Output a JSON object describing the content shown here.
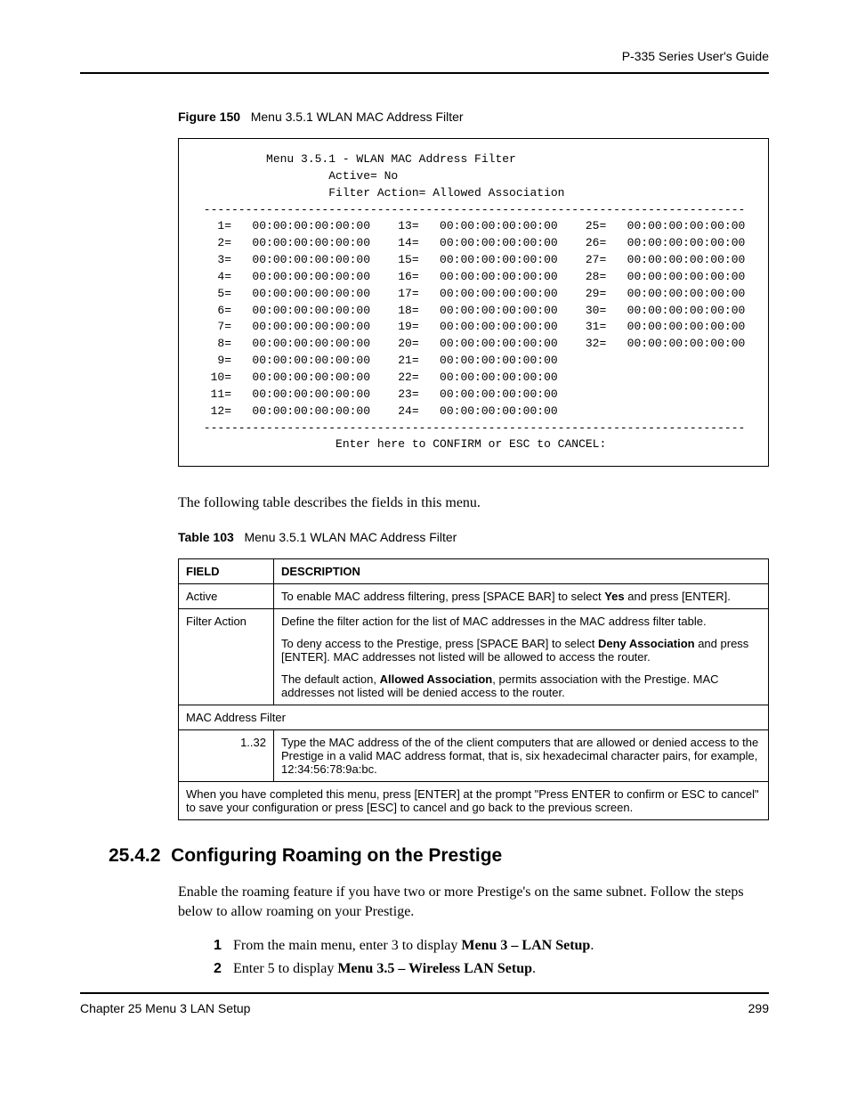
{
  "header": {
    "running": "P-335 Series User's Guide"
  },
  "figure": {
    "num": "Figure 150",
    "title": "Menu 3.5.1 WLAN MAC Address Filter"
  },
  "terminal": {
    "title": "Menu 3.5.1 - WLAN MAC Address Filter",
    "active_label": "Active=",
    "active_value": "No",
    "filter_action_label": "Filter Action=",
    "filter_action_value": "Allowed Association",
    "separator": "------------------------------------------------------------------------------",
    "footer": "Enter here to CONFIRM or ESC to CANCEL:",
    "mac": "00:00:00:00:00:00",
    "col1_count": 12,
    "col2_start": 13,
    "col2_count": 12,
    "col3_start": 25,
    "col3_count": 8
  },
  "after_figure_text": "The following table describes the fields in this menu.",
  "table": {
    "num": "Table 103",
    "title": "Menu 3.5.1 WLAN MAC Address Filter",
    "head_field": "FIELD",
    "head_desc": "DESCRIPTION",
    "rows": {
      "r0_field": "Active",
      "r0_desc": "To enable MAC address filtering, press [SPACE BAR] to select Yes and press [ENTER].",
      "r1_field": "Filter Action",
      "r1_p1": "Define the filter action for the list of MAC addresses in the MAC address filter table.",
      "r1_p2a": "To deny access to the Prestige, press [SPACE BAR] to select ",
      "r1_p2b": "Deny Association",
      "r1_p2c": " and press [ENTER].  MAC addresses not listed will be allowed to access the router.",
      "r1_p3a": "The default action, ",
      "r1_p3b": "Allowed Association",
      "r1_p3c": ", permits association with the Prestige. MAC addresses not listed will be denied access to the router.",
      "r2_span": "MAC Address Filter",
      "r3_field": "1..32",
      "r3_desc": "Type the MAC address of the of the client computers that are allowed or denied access to the Prestige in a valid MAC address format, that is, six hexadecimal character pairs, for example, 12:34:56:78:9a:bc.",
      "r4_span": "When you have completed this menu, press [ENTER] at the prompt \"Press ENTER to confirm or ESC to cancel\" to save your configuration or press [ESC] to cancel and go back to the previous screen."
    }
  },
  "section": {
    "num": "25.4.2",
    "title": "Configuring Roaming on the Prestige",
    "intro": "Enable the roaming feature if you have two or more Prestige's on the same subnet. Follow the steps below to allow roaming on your Prestige.",
    "steps": {
      "s1a": "From the main menu, enter 3 to display ",
      "s1b": "Menu 3 – LAN Setup",
      "s1c": ".",
      "s2a": "Enter 5 to display ",
      "s2b": "Menu 3.5 – Wireless LAN Setup",
      "s2c": "."
    }
  },
  "footer": {
    "left": "Chapter 25 Menu 3 LAN Setup",
    "right": "299"
  }
}
